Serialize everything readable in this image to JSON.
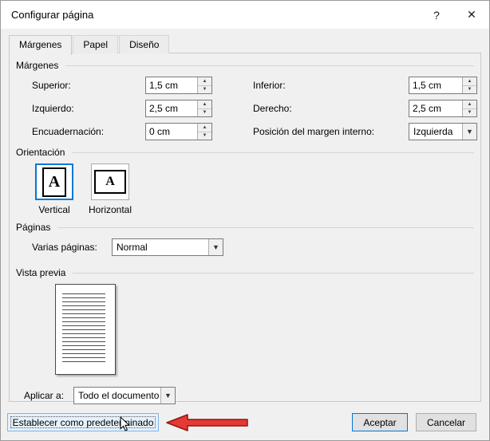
{
  "dialog": {
    "title": "Configurar página",
    "help_label": "?",
    "close_label": "✕"
  },
  "tabs": [
    {
      "label": "Márgenes",
      "active": true
    },
    {
      "label": "Papel",
      "active": false
    },
    {
      "label": "Diseño",
      "active": false
    }
  ],
  "margins": {
    "section_title": "Márgenes",
    "superior": {
      "label": "Superior:",
      "value": "1,5 cm"
    },
    "inferior": {
      "label": "Inferior:",
      "value": "1,5 cm"
    },
    "izquierdo": {
      "label": "Izquierdo:",
      "value": "2,5 cm"
    },
    "derecho": {
      "label": "Derecho:",
      "value": "2,5 cm"
    },
    "encuadernacion": {
      "label": "Encuadernación:",
      "value": "0 cm"
    },
    "posicion": {
      "label": "Posición del margen interno:",
      "value": "Izquierda"
    }
  },
  "orientation": {
    "section_title": "Orientación",
    "icon_letter": "A",
    "vertical_label": "Vertical",
    "horizontal_label": "Horizontal",
    "selected": "Vertical"
  },
  "pages": {
    "section_title": "Páginas",
    "label": "Varias páginas:",
    "value": "Normal"
  },
  "preview": {
    "section_title": "Vista previa",
    "apply_label": "Aplicar a:",
    "apply_value": "Todo el documento"
  },
  "footer": {
    "default_button": "Establecer como predeterminado",
    "ok_button": "Aceptar",
    "cancel_button": "Cancelar"
  },
  "colors": {
    "accent_blue": "#0078d7",
    "annotation_red": "#e63934"
  }
}
